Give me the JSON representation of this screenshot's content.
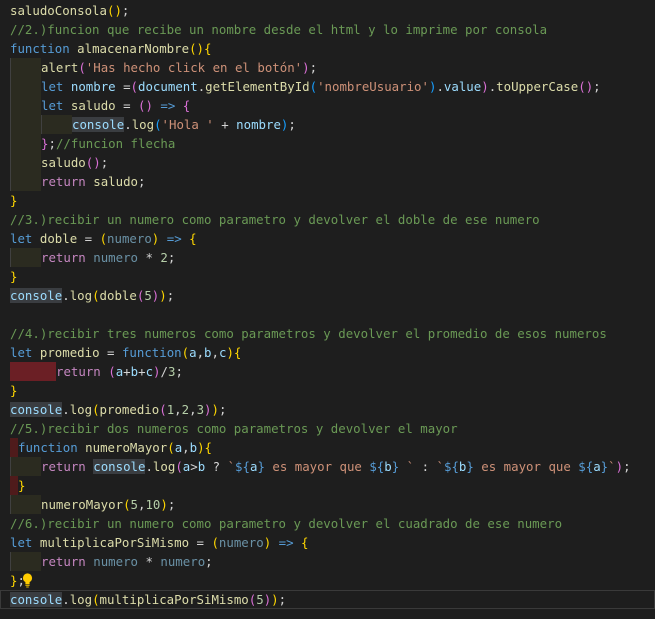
{
  "icons": {
    "lightbulb": "lightbulb-icon"
  },
  "colors": {
    "background": "#1e1e1e",
    "function": "#dcdcaa",
    "comment": "#6a9955",
    "keyword": "#569cd6",
    "control": "#c586c0",
    "variable": "#9cdcfe",
    "class": "#4ec9b0",
    "string": "#ce9178",
    "number": "#b5cea8",
    "bracket1": "#ffd700",
    "bracket2": "#da70d6",
    "bracket3": "#179fff",
    "lightbulb": "#ffcc00"
  },
  "editor": {
    "lines": [
      {
        "indent": [],
        "tokens": [
          {
            "t": "saludoConsola",
            "c": "fn"
          },
          {
            "t": "()",
            "c": "p1"
          },
          {
            "t": ";",
            "c": "pl"
          }
        ]
      },
      {
        "indent": [],
        "tokens": [
          {
            "t": "//2.)funcion que recibe un nombre desde el html y lo imprime por consola",
            "c": "cm"
          }
        ]
      },
      {
        "indent": [],
        "tokens": [
          {
            "t": "function",
            "c": "kw"
          },
          {
            "t": " ",
            "c": "pl"
          },
          {
            "t": "almacenarNombre",
            "c": "fn"
          },
          {
            "t": "(){",
            "c": "p1"
          }
        ]
      },
      {
        "indent": [
          "guide"
        ],
        "tokens": [
          {
            "t": "alert",
            "c": "fn"
          },
          {
            "t": "(",
            "c": "p2"
          },
          {
            "t": "'Has hecho click en el botón'",
            "c": "str"
          },
          {
            "t": ")",
            "c": "p2"
          },
          {
            "t": ";",
            "c": "pl"
          }
        ]
      },
      {
        "indent": [
          "guide"
        ],
        "tokens": [
          {
            "t": "let",
            "c": "kw"
          },
          {
            "t": " ",
            "c": "pl"
          },
          {
            "t": "nombre",
            "c": "var"
          },
          {
            "t": " =",
            "c": "pl"
          },
          {
            "t": "(",
            "c": "p2"
          },
          {
            "t": "document",
            "c": "var"
          },
          {
            "t": ".",
            "c": "pl"
          },
          {
            "t": "getElementById",
            "c": "fn"
          },
          {
            "t": "(",
            "c": "p3"
          },
          {
            "t": "'nombreUsuario'",
            "c": "str"
          },
          {
            "t": ")",
            "c": "p3"
          },
          {
            "t": ".",
            "c": "pl"
          },
          {
            "t": "value",
            "c": "var"
          },
          {
            "t": ")",
            "c": "p2"
          },
          {
            "t": ".",
            "c": "pl"
          },
          {
            "t": "toUpperCase",
            "c": "fn"
          },
          {
            "t": "()",
            "c": "p2"
          },
          {
            "t": ";",
            "c": "pl"
          }
        ]
      },
      {
        "indent": [
          "guide"
        ],
        "tokens": [
          {
            "t": "let",
            "c": "kw"
          },
          {
            "t": " ",
            "c": "pl"
          },
          {
            "t": "saludo",
            "c": "fn"
          },
          {
            "t": " = ",
            "c": "pl"
          },
          {
            "t": "()",
            "c": "p2"
          },
          {
            "t": " ",
            "c": "pl"
          },
          {
            "t": "=>",
            "c": "kw"
          },
          {
            "t": " ",
            "c": "pl"
          },
          {
            "t": "{",
            "c": "p2"
          }
        ]
      },
      {
        "indent": [
          "guide",
          "guide"
        ],
        "tokens": [
          {
            "t": "console",
            "c": "var",
            "hl": true
          },
          {
            "t": ".",
            "c": "pl"
          },
          {
            "t": "log",
            "c": "fn"
          },
          {
            "t": "(",
            "c": "p3"
          },
          {
            "t": "'Hola '",
            "c": "str"
          },
          {
            "t": " + ",
            "c": "pl"
          },
          {
            "t": "nombre",
            "c": "var"
          },
          {
            "t": ")",
            "c": "p3"
          },
          {
            "t": ";",
            "c": "pl"
          }
        ]
      },
      {
        "indent": [
          "guide"
        ],
        "tokens": [
          {
            "t": "}",
            "c": "p2"
          },
          {
            "t": ";",
            "c": "pl"
          },
          {
            "t": "//funcion flecha",
            "c": "cm"
          }
        ]
      },
      {
        "indent": [
          "guide"
        ],
        "tokens": [
          {
            "t": "saludo",
            "c": "fn"
          },
          {
            "t": "()",
            "c": "p2"
          },
          {
            "t": ";",
            "c": "pl"
          }
        ]
      },
      {
        "indent": [
          "guide"
        ],
        "tokens": [
          {
            "t": "return",
            "c": "ctl"
          },
          {
            "t": " ",
            "c": "pl"
          },
          {
            "t": "saludo",
            "c": "fn"
          },
          {
            "t": ";",
            "c": "pl"
          }
        ]
      },
      {
        "indent": [],
        "tokens": [
          {
            "t": "}",
            "c": "p1"
          }
        ]
      },
      {
        "indent": [],
        "tokens": [
          {
            "t": "//3.)recibir un numero como parametro y devolver el doble de ese numero",
            "c": "cm"
          }
        ]
      },
      {
        "indent": [],
        "tokens": [
          {
            "t": "let",
            "c": "kw"
          },
          {
            "t": " ",
            "c": "pl"
          },
          {
            "t": "doble",
            "c": "fn"
          },
          {
            "t": " = ",
            "c": "pl"
          },
          {
            "t": "(",
            "c": "p1"
          },
          {
            "t": "numero",
            "c": "dim"
          },
          {
            "t": ")",
            "c": "p1"
          },
          {
            "t": " ",
            "c": "pl"
          },
          {
            "t": "=>",
            "c": "kw"
          },
          {
            "t": " ",
            "c": "pl"
          },
          {
            "t": "{",
            "c": "p1"
          }
        ]
      },
      {
        "indent": [
          "guide"
        ],
        "tokens": [
          {
            "t": "return",
            "c": "ctl"
          },
          {
            "t": " ",
            "c": "pl"
          },
          {
            "t": "numero",
            "c": "dim"
          },
          {
            "t": " * ",
            "c": "pl"
          },
          {
            "t": "2",
            "c": "num"
          },
          {
            "t": ";",
            "c": "pl"
          }
        ]
      },
      {
        "indent": [],
        "tokens": [
          {
            "t": "}",
            "c": "p1"
          }
        ]
      },
      {
        "indent": [],
        "tokens": [
          {
            "t": "console",
            "c": "var",
            "hl": true
          },
          {
            "t": ".",
            "c": "pl"
          },
          {
            "t": "log",
            "c": "fn"
          },
          {
            "t": "(",
            "c": "p1"
          },
          {
            "t": "doble",
            "c": "fn"
          },
          {
            "t": "(",
            "c": "p2"
          },
          {
            "t": "5",
            "c": "num"
          },
          {
            "t": ")",
            "c": "p2"
          },
          {
            "t": ")",
            "c": "p1"
          },
          {
            "t": ";",
            "c": "pl"
          }
        ]
      },
      {
        "indent": [],
        "tokens": []
      },
      {
        "indent": [],
        "tokens": [
          {
            "t": "//4.)recibir tres numeros como parametros y devolver el promedio de esos numeros",
            "c": "cm"
          }
        ]
      },
      {
        "indent": [],
        "tokens": [
          {
            "t": "let",
            "c": "kw"
          },
          {
            "t": " ",
            "c": "pl"
          },
          {
            "t": "promedio",
            "c": "fn"
          },
          {
            "t": " = ",
            "c": "pl"
          },
          {
            "t": "function",
            "c": "kw"
          },
          {
            "t": "(",
            "c": "p1"
          },
          {
            "t": "a",
            "c": "var"
          },
          {
            "t": ",",
            "c": "pl"
          },
          {
            "t": "b",
            "c": "var"
          },
          {
            "t": ",",
            "c": "pl"
          },
          {
            "t": "c",
            "c": "var"
          },
          {
            "t": "){",
            "c": "p1"
          }
        ]
      },
      {
        "indent": [
          "mark"
        ],
        "indentWidth": 46,
        "tokens": [
          {
            "t": "return",
            "c": "ctl"
          },
          {
            "t": " ",
            "c": "pl"
          },
          {
            "t": "(",
            "c": "p2"
          },
          {
            "t": "a",
            "c": "var"
          },
          {
            "t": "+",
            "c": "pl"
          },
          {
            "t": "b",
            "c": "var"
          },
          {
            "t": "+",
            "c": "pl"
          },
          {
            "t": "c",
            "c": "var"
          },
          {
            "t": ")",
            "c": "p2"
          },
          {
            "t": "/",
            "c": "pl"
          },
          {
            "t": "3",
            "c": "num"
          },
          {
            "t": ";",
            "c": "pl"
          }
        ]
      },
      {
        "indent": [],
        "tokens": [
          {
            "t": "}",
            "c": "p1"
          }
        ]
      },
      {
        "indent": [],
        "tokens": [
          {
            "t": "console",
            "c": "var",
            "hl": true
          },
          {
            "t": ".",
            "c": "pl"
          },
          {
            "t": "log",
            "c": "fn"
          },
          {
            "t": "(",
            "c": "p1"
          },
          {
            "t": "promedio",
            "c": "fn"
          },
          {
            "t": "(",
            "c": "p2"
          },
          {
            "t": "1",
            "c": "num"
          },
          {
            "t": ",",
            "c": "pl"
          },
          {
            "t": "2",
            "c": "num"
          },
          {
            "t": ",",
            "c": "pl"
          },
          {
            "t": "3",
            "c": "num"
          },
          {
            "t": ")",
            "c": "p2"
          },
          {
            "t": ")",
            "c": "p1"
          },
          {
            "t": ";",
            "c": "pl"
          }
        ]
      },
      {
        "indent": [],
        "tokens": [
          {
            "t": "//5.)recibir dos numeros como parametros y devolver el mayor",
            "c": "cm"
          }
        ]
      },
      {
        "indent": [
          "warn"
        ],
        "indentWidth": 8,
        "tokens": [
          {
            "t": "function",
            "c": "kw"
          },
          {
            "t": " ",
            "c": "pl"
          },
          {
            "t": "numeroMayor",
            "c": "fn"
          },
          {
            "t": "(",
            "c": "p1"
          },
          {
            "t": "a",
            "c": "var"
          },
          {
            "t": ",",
            "c": "pl"
          },
          {
            "t": "b",
            "c": "var"
          },
          {
            "t": "){",
            "c": "p1"
          }
        ]
      },
      {
        "indent": [
          "guide"
        ],
        "tokens": [
          {
            "t": "return",
            "c": "ctl"
          },
          {
            "t": " ",
            "c": "pl"
          },
          {
            "t": "console",
            "c": "var",
            "hl": true
          },
          {
            "t": ".",
            "c": "pl"
          },
          {
            "t": "log",
            "c": "fn"
          },
          {
            "t": "(",
            "c": "p2"
          },
          {
            "t": "a",
            "c": "var"
          },
          {
            "t": ">",
            "c": "pl"
          },
          {
            "t": "b",
            "c": "var"
          },
          {
            "t": " ? ",
            "c": "pl"
          },
          {
            "t": "`",
            "c": "str"
          },
          {
            "t": "${",
            "c": "kw"
          },
          {
            "t": "a",
            "c": "var"
          },
          {
            "t": "}",
            "c": "kw"
          },
          {
            "t": " es mayor que ",
            "c": "str"
          },
          {
            "t": "${",
            "c": "kw"
          },
          {
            "t": "b",
            "c": "var"
          },
          {
            "t": "}",
            "c": "kw"
          },
          {
            "t": " `",
            "c": "str"
          },
          {
            "t": " : ",
            "c": "pl"
          },
          {
            "t": "`",
            "c": "str"
          },
          {
            "t": "${",
            "c": "kw"
          },
          {
            "t": "b",
            "c": "var"
          },
          {
            "t": "}",
            "c": "kw"
          },
          {
            "t": " es mayor que ",
            "c": "str"
          },
          {
            "t": "${",
            "c": "kw"
          },
          {
            "t": "a",
            "c": "var"
          },
          {
            "t": "}",
            "c": "kw"
          },
          {
            "t": "`",
            "c": "str"
          },
          {
            "t": ")",
            "c": "p2"
          },
          {
            "t": ";",
            "c": "pl"
          }
        ]
      },
      {
        "indent": [
          "warn"
        ],
        "indentWidth": 8,
        "tokens": [
          {
            "t": "}",
            "c": "p1"
          }
        ]
      },
      {
        "indent": [
          "guide"
        ],
        "tokens": [
          {
            "t": "numeroMayor",
            "c": "fn"
          },
          {
            "t": "(",
            "c": "p1"
          },
          {
            "t": "5",
            "c": "num"
          },
          {
            "t": ",",
            "c": "pl"
          },
          {
            "t": "10",
            "c": "num"
          },
          {
            "t": ")",
            "c": "p1"
          },
          {
            "t": ";",
            "c": "pl"
          }
        ]
      },
      {
        "indent": [],
        "tokens": [
          {
            "t": "//6.)recibir un numero como parametro y devolver el cuadrado de ese numero",
            "c": "cm"
          }
        ]
      },
      {
        "indent": [],
        "tokens": [
          {
            "t": "let",
            "c": "kw"
          },
          {
            "t": " ",
            "c": "pl"
          },
          {
            "t": "multiplicaPorSiMismo",
            "c": "fn"
          },
          {
            "t": " = ",
            "c": "pl"
          },
          {
            "t": "(",
            "c": "p1"
          },
          {
            "t": "numero",
            "c": "dim"
          },
          {
            "t": ")",
            "c": "p1"
          },
          {
            "t": " ",
            "c": "pl"
          },
          {
            "t": "=>",
            "c": "kw"
          },
          {
            "t": " ",
            "c": "pl"
          },
          {
            "t": "{",
            "c": "p1"
          }
        ]
      },
      {
        "indent": [
          "guide"
        ],
        "tokens": [
          {
            "t": "return",
            "c": "ctl"
          },
          {
            "t": " ",
            "c": "pl"
          },
          {
            "t": "numero",
            "c": "dim"
          },
          {
            "t": " * ",
            "c": "pl"
          },
          {
            "t": "numero",
            "c": "dim"
          },
          {
            "t": ";",
            "c": "pl"
          }
        ]
      },
      {
        "indent": [],
        "bulb": true,
        "tokens": [
          {
            "t": "}",
            "c": "p1"
          },
          {
            "t": ";",
            "c": "pl"
          }
        ]
      },
      {
        "indent": [],
        "cursor": true,
        "tokens": [
          {
            "t": "console",
            "c": "var",
            "hl": true
          },
          {
            "t": ".",
            "c": "pl"
          },
          {
            "t": "log",
            "c": "fn"
          },
          {
            "t": "(",
            "c": "p1"
          },
          {
            "t": "multiplicaPorSiMismo",
            "c": "fn"
          },
          {
            "t": "(",
            "c": "p2"
          },
          {
            "t": "5",
            "c": "num"
          },
          {
            "t": ")",
            "c": "p2"
          },
          {
            "t": ")",
            "c": "p1"
          },
          {
            "t": ";",
            "c": "pl"
          }
        ]
      }
    ]
  }
}
